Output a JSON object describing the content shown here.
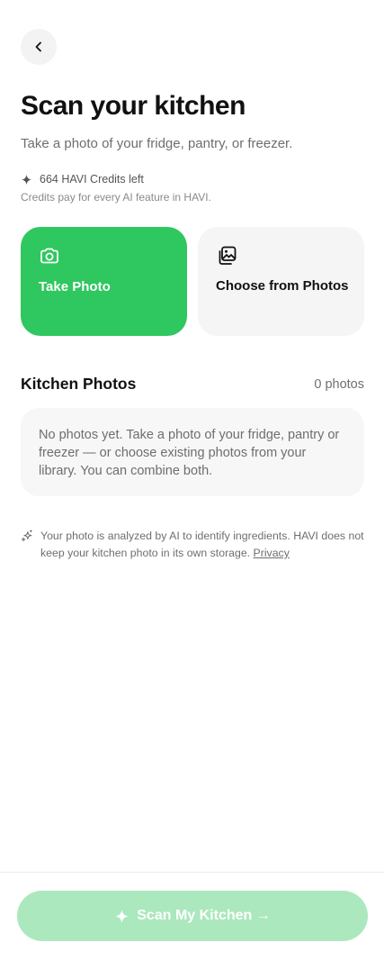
{
  "header": {
    "back_icon": "chevron-left-icon",
    "title": "Scan your kitchen",
    "subtitle": "Take a photo of your fridge, pantry, or freezer."
  },
  "credits": {
    "icon": "sparkle-icon",
    "label": "664 HAVI Credits left",
    "note": "Credits pay for every AI feature in HAVI."
  },
  "actions": {
    "take_photo": {
      "label": "Take Photo",
      "icon": "camera-icon",
      "color": "#2fc75f"
    },
    "choose_photos": {
      "label": "Choose from Photos",
      "icon": "gallery-icon"
    }
  },
  "kitchen_photos": {
    "title": "Kitchen Photos",
    "count_label": "0 photos",
    "empty_text": "No photos yet. Take a photo of your fridge, pantry or freezer — or choose existing photos from your library. You can combine both."
  },
  "ai_note": {
    "icon": "sparkles-icon",
    "text": "Your photo is analyzed by AI to identify ingredients. HAVI does not keep your kitchen photo in its own storage.",
    "link_label": "Privacy"
  },
  "footer": {
    "scan_button_label": "Scan My Kitchen →",
    "scan_button_icon": "sparkle-icon",
    "scan_button_color": "#abe8bd"
  }
}
